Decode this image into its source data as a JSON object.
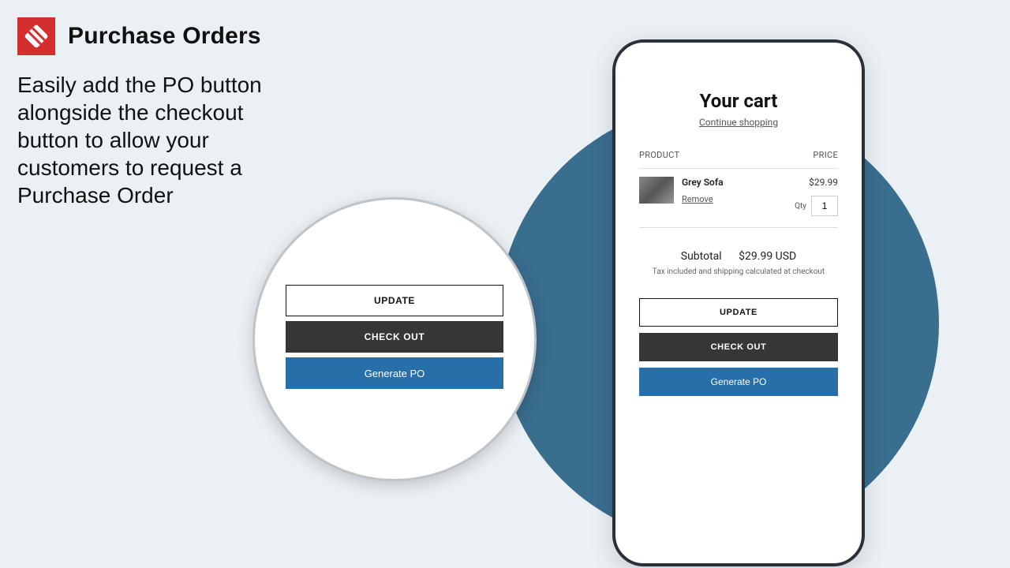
{
  "header": {
    "app_title": "Purchase Orders"
  },
  "blurb": "Easily add the PO button alongside the checkout button to allow your customers to request a Purchase Order",
  "zoom": {
    "update": "UPDATE",
    "checkout": "CHECK OUT",
    "generate": "Generate PO"
  },
  "cart": {
    "title": "Your cart",
    "continue": "Continue shopping",
    "col_product": "PRODUCT",
    "col_price": "PRICE",
    "item": {
      "name": "Grey Sofa",
      "price": "$29.99",
      "remove": "Remove",
      "qty_label": "Qty",
      "qty_value": "1"
    },
    "subtotal_label": "Subtotal",
    "subtotal_value": "$29.99 USD",
    "tax_note": "Tax included and shipping calculated at checkout",
    "buttons": {
      "update": "UPDATE",
      "checkout": "CHECK OUT",
      "generate": "Generate PO"
    }
  }
}
